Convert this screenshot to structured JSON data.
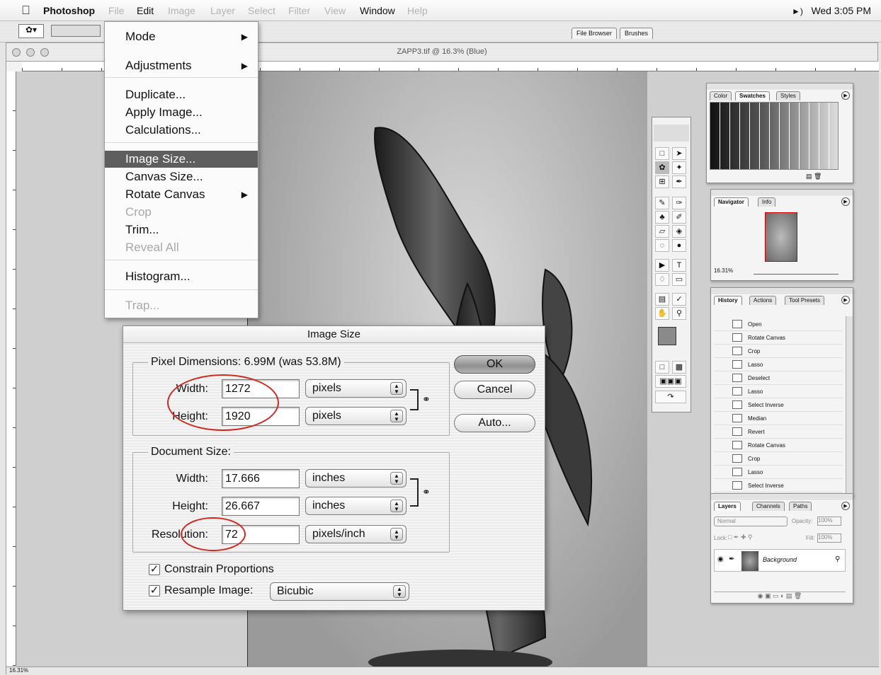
{
  "menubar": {
    "app_name": "Photoshop",
    "items": [
      "File",
      "Edit",
      "Image",
      "Layer",
      "Select",
      "Filter",
      "View",
      "Window",
      "Help"
    ],
    "clock": "Wed 3:05 PM"
  },
  "optionsbar": {
    "tabs": [
      "File Browser",
      "Brushes"
    ]
  },
  "document": {
    "title": "ZAPP3.tif @ 16.3% (Blue)",
    "zoom_status": "16.31%"
  },
  "image_menu": {
    "items": [
      {
        "label": "Mode",
        "submenu": true
      },
      {
        "label": "Adjustments",
        "submenu": true
      },
      {
        "label": "Duplicate..."
      },
      {
        "label": "Apply Image..."
      },
      {
        "label": "Calculations..."
      },
      {
        "label": "Image Size...",
        "selected": true
      },
      {
        "label": "Canvas Size..."
      },
      {
        "label": "Rotate Canvas",
        "submenu": true
      },
      {
        "label": "Crop",
        "disabled": true
      },
      {
        "label": "Trim..."
      },
      {
        "label": "Reveal All",
        "disabled": true
      },
      {
        "label": "Histogram..."
      },
      {
        "label": "Trap...",
        "disabled": true
      }
    ]
  },
  "dialog": {
    "title": "Image Size",
    "pixel_dimensions_label": "Pixel Dimensions:  6.99M (was 53.8M)",
    "pixel_width_label": "Width:",
    "pixel_width_value": "1272",
    "pixel_width_unit": "pixels",
    "pixel_height_label": "Height:",
    "pixel_height_value": "1920",
    "pixel_height_unit": "pixels",
    "document_size_label": "Document Size:",
    "doc_width_label": "Width:",
    "doc_width_value": "17.666",
    "doc_width_unit": "inches",
    "doc_height_label": "Height:",
    "doc_height_value": "26.667",
    "doc_height_unit": "inches",
    "resolution_label": "Resolution:",
    "resolution_value": "72",
    "resolution_unit": "pixels/inch",
    "constrain_label": "Constrain Proportions",
    "constrain_checked": true,
    "resample_label": "Resample Image:",
    "resample_checked": true,
    "resample_method": "Bicubic",
    "ok_label": "OK",
    "cancel_label": "Cancel",
    "auto_label": "Auto..."
  },
  "palettes": {
    "swatches_tabs": [
      "Color",
      "Swatches",
      "Styles"
    ],
    "navigator_tabs": [
      "Navigator",
      "Info"
    ],
    "navigator_zoom": "16.31%",
    "history_tabs": [
      "History",
      "Actions",
      "Tool Presets"
    ],
    "history_items": [
      "Open",
      "Rotate Canvas",
      "Crop",
      "Lasso",
      "Deselect",
      "Lasso",
      "Select Inverse",
      "Median",
      "Revert",
      "Rotate Canvas",
      "Crop",
      "Lasso",
      "Select Inverse"
    ],
    "layers_tabs": [
      "Layers",
      "Channels",
      "Paths"
    ],
    "blend_mode": "Normal",
    "opacity_label": "Opacity:",
    "opacity_value": "100%",
    "lock_label": "Lock:",
    "fill_label": "Fill:",
    "fill_value": "100%",
    "layer_name": "Background"
  }
}
